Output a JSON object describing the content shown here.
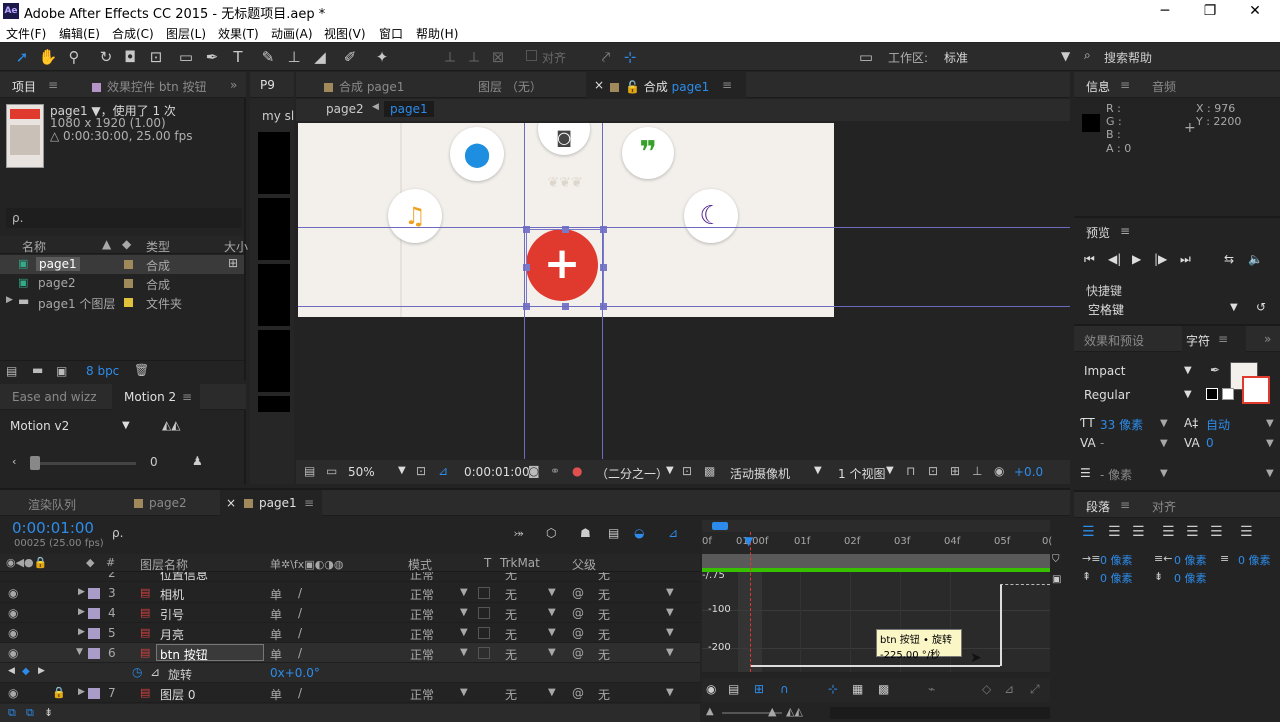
{
  "window": {
    "app_icon": "Ae",
    "title": "Adobe After Effects CC 2015 - 无标题项目.aep *",
    "minimize": "─",
    "maximize": "❐",
    "close": "✕"
  },
  "menu": [
    "文件(F)",
    "编辑(E)",
    "合成(C)",
    "图层(L)",
    "效果(T)",
    "动画(A)",
    "视图(V)",
    "窗口",
    "帮助(H)"
  ],
  "toolbar": {
    "snap_label": "对齐",
    "workspace_label": "工作区:",
    "workspace_value": "标准",
    "search_help": "搜索帮助"
  },
  "project_panel": {
    "tab_project": "项目",
    "tab_effects": "效果控件 btn 按钮",
    "comp_name": "page1 ▼，使用了 1 次",
    "dims": "1080 x 1920 (1.00)",
    "duration": "△ 0:00:30:00, 25.00 fps",
    "search_placeholder": "ρ.",
    "col_name": "名称",
    "col_type": "类型",
    "col_size": "大小",
    "items": [
      {
        "name": "page1",
        "type": "合成",
        "color": "#a08a5c"
      },
      {
        "name": "page2",
        "type": "合成",
        "color": "#a08a5c"
      },
      {
        "name": "page1 个图层",
        "type": "文件夹",
        "color": "#e0c23a"
      }
    ],
    "bpc": "8 bpc"
  },
  "ease_panel": {
    "tab1": "Ease and wizz",
    "tab2": "Motion 2",
    "preset": "Motion v2",
    "value": "0"
  },
  "side_strip": {
    "tab": "P9",
    "label": "my sl"
  },
  "viewer": {
    "tab_footage": "合成 page1",
    "tab_layer": "图层 （无）",
    "tab_comp_prefix": "合成",
    "tab_comp_name": "page1",
    "crumb1": "page2",
    "crumb2": "page1",
    "zoom": "50%",
    "timecode": "0:00:01:00",
    "resolution": "（二分之一）",
    "camera": "活动摄像机",
    "views": "1 个视图",
    "exposure": "+0.0"
  },
  "info_panel": {
    "tab_info": "信息",
    "tab_audio": "音频",
    "r": "R :",
    "g": "G :",
    "b": "B :",
    "a": "A : 0",
    "x": "X : 976",
    "y": "Y : 2200"
  },
  "preview_panel": {
    "tab": "预览",
    "shortcut_label": "快捷键",
    "shortcut_value": "空格键"
  },
  "char_panel": {
    "tab_effects": "效果和预设",
    "tab_char": "字符",
    "font": "Impact",
    "style": "Regular",
    "size": "33 像素",
    "leading": "自动",
    "tracking": "0",
    "kern": "-",
    "stroke": "- 像素"
  },
  "para_panel": {
    "tab_para": "段落",
    "tab_align": "对齐",
    "indent1": "0 像素",
    "indent2": "0 像素",
    "indent3": "0 像素",
    "space1": "0 像素",
    "space2": "0 像素"
  },
  "timeline": {
    "tab_render": "渲染队列",
    "tab_page2": "page2",
    "tab_page1": "page1",
    "timecode": "0:00:01:00",
    "frames": "00025 (25.00 fps)",
    "search_placeholder": "ρ.",
    "col_name": "图层名称",
    "col_mode": "模式",
    "col_t": "T",
    "col_trkmat": "TrkMat",
    "col_parent": "父级",
    "layers": [
      {
        "num": "2",
        "name": "位置信息",
        "mode": "正常",
        "trk": "无",
        "parent": "无"
      },
      {
        "num": "3",
        "name": "相机",
        "mode": "正常",
        "trk": "无",
        "parent": "无"
      },
      {
        "num": "4",
        "name": "引号",
        "mode": "正常",
        "trk": "无",
        "parent": "无"
      },
      {
        "num": "5",
        "name": "月亮",
        "mode": "正常",
        "trk": "无",
        "parent": "无"
      },
      {
        "num": "6",
        "name": "btn 按钮",
        "mode": "正常",
        "trk": "无",
        "parent": "无"
      },
      {
        "num": "7",
        "name": "图层 0",
        "mode": "正常",
        "trk": "无",
        "parent": "无"
      }
    ],
    "prop_name": "旋转",
    "prop_value": "0x+0.0°",
    "ruler": [
      "0f",
      "01:00f",
      "01f",
      "02f",
      "03f",
      "04f",
      "05f",
      "0("
    ],
    "graph_labels": [
      "-100",
      "-200"
    ],
    "graph_top_label": "-/.75",
    "tooltip_line1": "btn 按钮 • 旋转",
    "tooltip_line2": "-225.00 °/秒"
  },
  "colors": {
    "accent": "#2d8ceb",
    "red_button": "#e03a2e",
    "guide": "#7a78c8",
    "comp_bg": "#f3f0ec",
    "green": "#36c000"
  }
}
